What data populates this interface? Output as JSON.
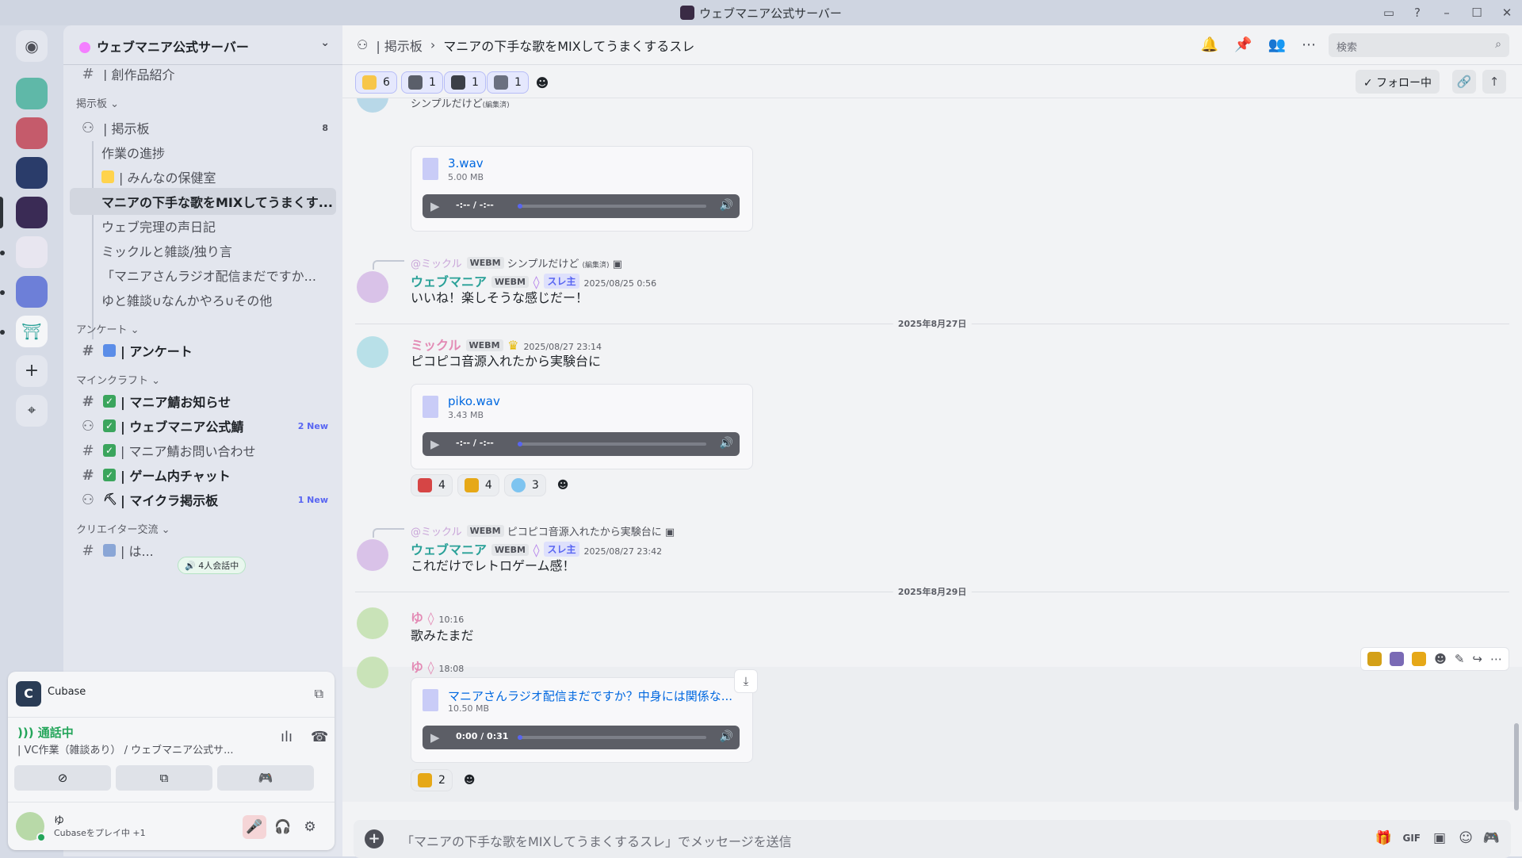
{
  "window": {
    "title": "ウェブマニア公式サーバー"
  },
  "sidebar": {
    "server_name": "ウェブマニア公式サーバー",
    "cut_channel": "| 創作品紹介",
    "categories": {
      "board": "掲示板",
      "survey": "アンケート",
      "minecraft": "マインクラフト",
      "creator": "クリエイター交流"
    },
    "forum": {
      "label": "| 掲示板",
      "badge": "8"
    },
    "threads": [
      "作業の進捗",
      "| みんなの保健室",
      "マニアの下手な歌をMIXしてうまくす...",
      "ウェブ完理の声日記",
      "ミックルと雑談/独り言",
      "「マニアさんラジオ配信まだですか...",
      "ゆと雑談∪なんかやろ∪その他"
    ],
    "survey_channel": "| アンケート",
    "mc_channels": [
      {
        "label": "| マニア鯖お知らせ",
        "badge": ""
      },
      {
        "label": "| ウェブマニア公式鯖",
        "badge": "2 New"
      },
      {
        "label": "| マニア鯖お問い合わせ",
        "badge": ""
      },
      {
        "label": "| ゲーム内チャット",
        "badge": ""
      },
      {
        "label": "| マイクラ掲示板",
        "badge": "1 New"
      }
    ],
    "creator_channel": "| は...",
    "vc_float": "4人会話中"
  },
  "panel": {
    "activity": "Cubase",
    "vc_status": "通話中",
    "vc_channel": "| VC作業（雑談あり） / ウェブマニア公式サ...",
    "user_name": "ゆ",
    "user_status": "Cubaseをプレイ中 +1"
  },
  "header": {
    "forum": "| 掲示板",
    "sep": "›",
    "thread": "マニアの下手な歌をMIXしてうまくするスレ",
    "search_placeholder": "検索"
  },
  "thread_bar": {
    "reactions": [
      "6",
      "1",
      "1",
      "1"
    ],
    "follow": "✓ フォロー中"
  },
  "messages": {
    "top_partial": "シンプルだけど",
    "top_edited": "(編集済)",
    "file1": {
      "name": "3.wav",
      "size": "5.00 MB",
      "time": "-:-- / -:--"
    },
    "m1": {
      "reply_name": "@ミックル",
      "reply_tag": "WEBM",
      "reply_text": "シンプルだけど",
      "reply_edited": "(編集済)",
      "name": "ウェブマニア",
      "tag": "WEBM",
      "op": "スレ主",
      "ts": "2025/08/25 0:56",
      "text": "いいね！楽しそうな感じだー！"
    },
    "date1": "2025年8月27日",
    "m2": {
      "name": "ミックル",
      "tag": "WEBM",
      "ts": "2025/08/27 23:14",
      "text": "ピコピコ音源入れたから実験台に"
    },
    "file2": {
      "name": "piko.wav",
      "size": "3.43 MB",
      "time": "-:-- / -:--"
    },
    "m2_reactions": [
      "4",
      "4",
      "3"
    ],
    "m3": {
      "reply_name": "@ミックル",
      "reply_tag": "WEBM",
      "reply_text": "ピコピコ音源入れたから実験台に",
      "name": "ウェブマニア",
      "tag": "WEBM",
      "op": "スレ主",
      "ts": "2025/08/27 23:42",
      "text": "これだけでレトロゲーム感！"
    },
    "date2": "2025年8月29日",
    "m4": {
      "name": "ゆ",
      "ts": "10:16",
      "text": "歌みたまだ"
    },
    "m5": {
      "name": "ゆ",
      "ts": "18:08"
    },
    "file3": {
      "name": "マニアさんラジオ配信まだですか？中身には関係な...",
      "size": "10.50 MB",
      "time": "0:00 / 0:31"
    },
    "m5_reactions": [
      "2"
    ]
  },
  "composer": {
    "placeholder": "「マニアの下手な歌をMIXしてうまくするスレ」でメッセージを送信"
  },
  "colors": {
    "accent": "#5865f2",
    "online": "#23a55a",
    "link": "#0068e0",
    "name_mania": "#2aa198",
    "name_mikkuru": "#e38bb5"
  }
}
